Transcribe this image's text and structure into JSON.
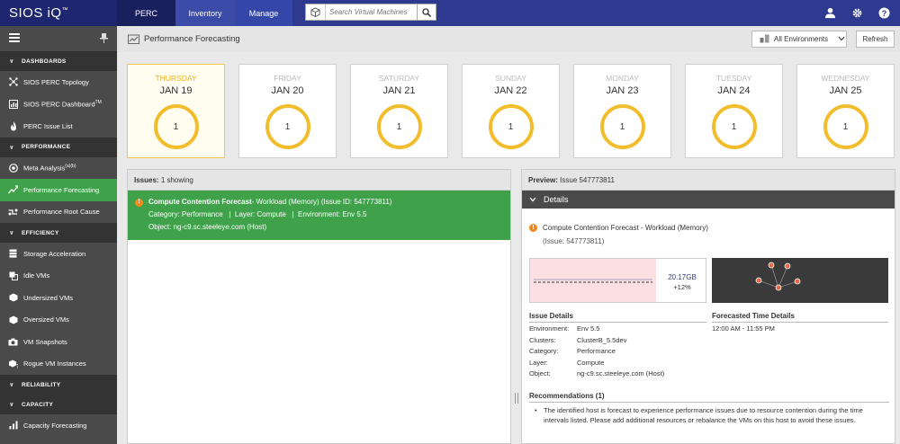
{
  "app": {
    "logo": "SIOS iQ",
    "logo_mark": "™"
  },
  "topnav": {
    "tabs": [
      "PERC",
      "Inventory",
      "Manage"
    ],
    "search_placeholder": "Search Virtual Machines"
  },
  "sidebar": {
    "sections": [
      {
        "title": "DASHBOARDS",
        "items": [
          {
            "label": "SIOS PERC Topology",
            "icon": "topology-icon"
          },
          {
            "label": "SIOS PERC Dashboard",
            "sup": "TM",
            "icon": "dashboard-icon"
          },
          {
            "label": "PERC Issue List",
            "icon": "flame-icon"
          }
        ]
      },
      {
        "title": "PERFORMANCE",
        "items": [
          {
            "label": "Meta Analysis",
            "sup": "(a)(b)",
            "icon": "meta-analysis-icon"
          },
          {
            "label": "Performance Forecasting",
            "icon": "forecasting-icon",
            "active": true
          },
          {
            "label": "Performance Root Cause",
            "icon": "root-cause-icon"
          }
        ]
      },
      {
        "title": "EFFICIENCY",
        "items": [
          {
            "label": "Storage Acceleration",
            "icon": "storage-icon"
          },
          {
            "label": "Idle VMs",
            "icon": "idle-vm-icon"
          },
          {
            "label": "Undersized VMs",
            "icon": "undersized-vm-icon"
          },
          {
            "label": "Oversized VMs",
            "icon": "oversized-vm-icon"
          },
          {
            "label": "VM Snapshots",
            "icon": "snapshot-icon"
          },
          {
            "label": "Rogue VM Instances",
            "icon": "rogue-vm-icon"
          }
        ]
      },
      {
        "title": "RELIABILITY",
        "items": []
      },
      {
        "title": "CAPACITY",
        "items": [
          {
            "label": "Capacity Forecasting",
            "icon": "capacity-icon"
          }
        ]
      }
    ]
  },
  "header": {
    "title": "Performance Forecasting",
    "env_select": "All Environments",
    "refresh_label": "Refresh"
  },
  "days": [
    {
      "name": "THURSDAY",
      "date": "JAN 19",
      "count": "1",
      "today": true
    },
    {
      "name": "FRIDAY",
      "date": "JAN 20",
      "count": "1"
    },
    {
      "name": "SATURDAY",
      "date": "JAN 21",
      "count": "1"
    },
    {
      "name": "SUNDAY",
      "date": "JAN 22",
      "count": "1"
    },
    {
      "name": "MONDAY",
      "date": "JAN 23",
      "count": "1"
    },
    {
      "name": "TUESDAY",
      "date": "JAN 24",
      "count": "1"
    },
    {
      "name": "WEDNESDAY",
      "date": "JAN 25",
      "count": "1"
    }
  ],
  "issues": {
    "header_label": "Issues:",
    "header_count": "1 showing",
    "item": {
      "title": "Compute Contention Forecast",
      "title_rest": " - Workload (Memory) (Issue ID: 547773811)",
      "line2": "Category: Performance   |  Layer: Compute   |  Environment: Env 5.5",
      "line3": "Object: ng-c9.sc.steeleye.com (Host)"
    }
  },
  "preview": {
    "header_label": "Preview:",
    "header_value": "Issue 547773811",
    "details_label": "Details",
    "title": "Compute Contention Forecast - Workload (Memory)",
    "issue_ref": "(Issue: 547773811)",
    "chart_value": "20.17GB",
    "chart_pct": "+12%",
    "issue_details_title": "Issue Details",
    "forecast_title": "Forecasted Time Details",
    "forecast_time": "12:00 AM - 11:55 PM",
    "fields": [
      {
        "k": "Environment:",
        "v": "Env 5.5"
      },
      {
        "k": "Clusters:",
        "v": "ClusterB_5.5dev"
      },
      {
        "k": "Category:",
        "v": "Performance"
      },
      {
        "k": "Layer:",
        "v": "Compute"
      },
      {
        "k": "Object:",
        "v": "ng-c9.sc.steeleye.com (Host)"
      }
    ],
    "recommendations_title": "Recommendations (1)",
    "recommendation": "The identified host is forecast to experience performance issues due to resource contention during the time intervals listed. Please add additional resources or rebalance the VMs on this host to avoid these issues."
  },
  "colors": {
    "topbar": "#2d3a8f",
    "active_green": "#3fa24a",
    "ring": "#f2bd2c",
    "warn": "#f08a1e"
  }
}
